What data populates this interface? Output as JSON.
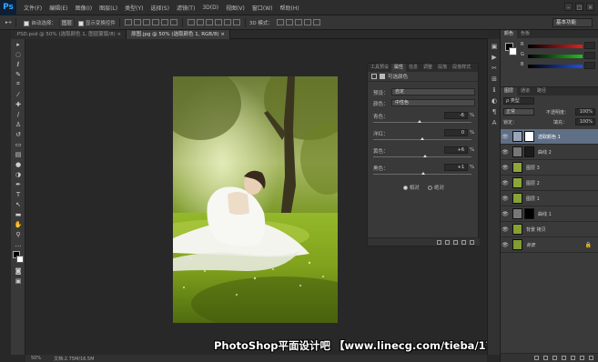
{
  "app": {
    "logo": "Ps"
  },
  "menu": [
    "文件(F)",
    "编辑(E)",
    "图像(I)",
    "图层(L)",
    "类型(Y)",
    "选择(S)",
    "滤镜(T)",
    "3D(D)",
    "视图(V)",
    "窗口(W)",
    "帮助(H)"
  ],
  "options": {
    "auto_select_label": "自动选择：",
    "auto_select_value": "图层",
    "show_transform_label": "显示变换控件",
    "mode_3d_label": "3D 模式：",
    "workspace": "基本功能"
  },
  "tabs": [
    {
      "label": ".PSD.psd @ 50% (选取颜色 1, 图层蒙版/8) ×",
      "active": false
    },
    {
      "label": "原图.jpg @ 50% (选取颜色 1, RGB/8) ×",
      "active": true
    }
  ],
  "status": {
    "zoom": "50%",
    "doc": "文档:2.75M/16.5M"
  },
  "watermark": "PhotoShop平面设计吧 【www.linecg.com/tieba/1783】",
  "properties": {
    "tabs": [
      "工具预设",
      "属性",
      "信息",
      "调整",
      "段落",
      "段落样式"
    ],
    "active_tab": "属性",
    "title": "可选颜色",
    "preset_label": "预设：",
    "preset_value": "自定",
    "colors_label": "颜色：",
    "colors_value": "中性色",
    "sliders": [
      {
        "label": "青色：",
        "value": "-6",
        "unit": "%"
      },
      {
        "label": "洋红：",
        "value": "0",
        "unit": "%"
      },
      {
        "label": "黄色：",
        "value": "+6",
        "unit": "%"
      },
      {
        "label": "黑色：",
        "value": "+1",
        "unit": "%"
      }
    ],
    "method_relative": "相对",
    "method_absolute": "绝对"
  },
  "color_panel": {
    "tabs": [
      "颜色",
      "色板"
    ],
    "rows": [
      {
        "label": "R",
        "color": "#e02020"
      },
      {
        "label": "G",
        "color": "#20c020"
      },
      {
        "label": "B",
        "color": "#2050e0"
      }
    ]
  },
  "layers_panel": {
    "tabs": [
      "图层",
      "通道",
      "路径"
    ],
    "kind_label": "ρ 类型",
    "blend_mode": "正常",
    "opacity_label": "不透明度：",
    "opacity_value": "100%",
    "lock_label": "锁定：",
    "fill_label": "填充：",
    "fill_value": "100%",
    "layers": [
      {
        "name": "选取颜色 1",
        "kind": "adjust-selective",
        "selected": true,
        "mask": "white"
      },
      {
        "name": "曲线 2",
        "kind": "adjust-curves",
        "selected": false,
        "mask": "dark"
      },
      {
        "name": "图层 3",
        "kind": "pixel",
        "selected": false,
        "mask": ""
      },
      {
        "name": "图层 2",
        "kind": "pixel",
        "selected": false,
        "mask": ""
      },
      {
        "name": "图层 1",
        "kind": "pixel",
        "selected": false,
        "mask": ""
      },
      {
        "name": "曲线 1",
        "kind": "adjust-curves",
        "selected": false,
        "mask": "black"
      },
      {
        "name": "背景 拷贝",
        "kind": "pixel",
        "selected": false,
        "mask": ""
      },
      {
        "name": "背景",
        "kind": "pixel",
        "selected": false,
        "mask": "",
        "locked": true
      }
    ]
  }
}
